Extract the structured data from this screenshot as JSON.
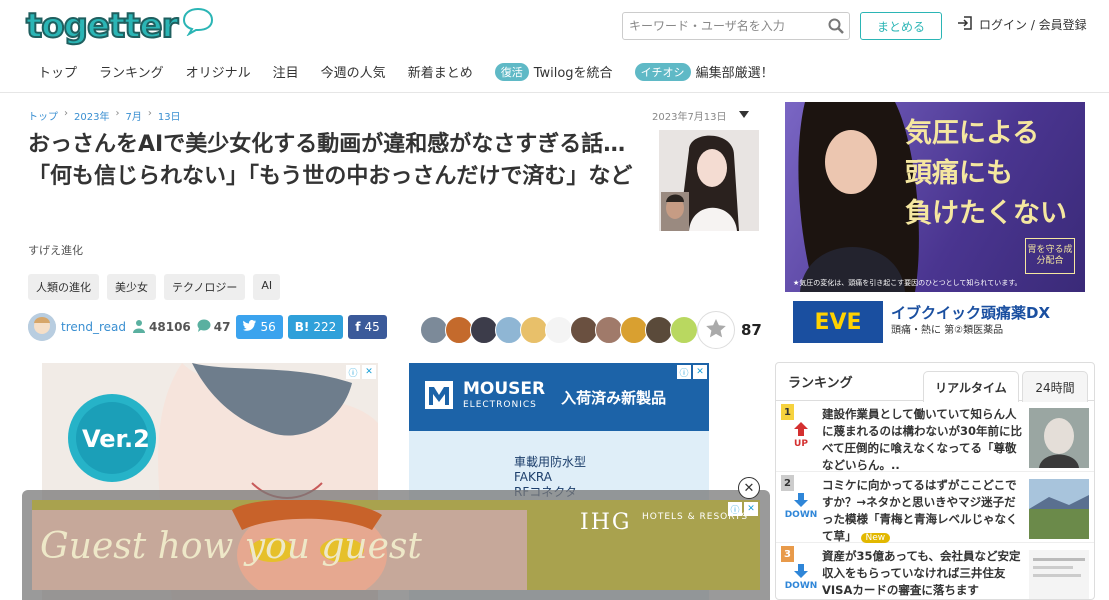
{
  "header": {
    "logo_text": "togetter",
    "search_placeholder": "キーワード・ユーザ名を入力",
    "matome_button": "まとめる",
    "login_label": "ログイン / 会員登録"
  },
  "nav": {
    "items": [
      "トップ",
      "ランキング",
      "オリジナル",
      "注目",
      "今週の人気",
      "新着まとめ"
    ],
    "promo1_tag": "復活",
    "promo1_label": "Twilogを統合",
    "promo2_tag": "イチオシ",
    "promo2_label": "編集部厳選！"
  },
  "breadcrumb": [
    "トップ",
    "2023年",
    "7月",
    "13日"
  ],
  "article": {
    "date": "2023年7月13日",
    "title": "おっさんをAIで美少女化する動画が違和感がなさすぎる話…「何も信じられない」「もう世の中おっさんだけで済む」など",
    "category": "すげえ進化",
    "tags": [
      "人類の進化",
      "美少女",
      "テクノロジー",
      "AI"
    ],
    "username": "trend_read",
    "views": "48106",
    "comments": "47",
    "twitter_count": "56",
    "hatena_label": "B!",
    "hatena_count": "222",
    "facebook_label": "f",
    "facebook_count": "45",
    "favorite_count": "87"
  },
  "ads": {
    "left_version": "Ver.2",
    "mouser_brand": "MOUSER",
    "mouser_sub": "ELECTRONICS",
    "mouser_headline": "入荷済み新製品",
    "mouser_body": [
      "車載用防水型",
      "FAKRA",
      "RFコネクタ"
    ],
    "sticky_headline": "Guest how you guest",
    "sticky_brand": "IHG",
    "sticky_brand_sub": "HOTELS & RESORTS",
    "side_copy_lines": [
      "気圧による",
      "頭痛にも",
      "負けたくない"
    ],
    "side_badge": "胃を守る成分配合",
    "side_note": "★気圧の変化は、頭痛を引き起こす要因のひとつとして知られています。",
    "side_brand": "EVE",
    "side_product": "イブクイック頭痛薬DX",
    "side_product_sub": "頭痛・熱に 第②類医薬品"
  },
  "ranking": {
    "title": "ランキング",
    "tab_realtime": "リアルタイム",
    "tab_24h": "24時間",
    "items": [
      {
        "rank": "1",
        "trend": "UP",
        "text": "建設作業員として働いていて知らん人に蔑まれるのは構わないが30年前に比べて圧倒的に喰えなくなってる「尊敬などいらん。.."
      },
      {
        "rank": "2",
        "trend": "DOWN",
        "text": "コミケに向かってるはずがここどこですか？→ネタかと思いきやマジ迷子だった模様「青梅と青海レベルじゃなくて草」",
        "badge": "New"
      },
      {
        "rank": "3",
        "trend": "DOWN",
        "text": "資産が35億あっても、会社員など安定収入をもらっていなければ三井住友VISAカードの審査に落ちます"
      }
    ]
  }
}
